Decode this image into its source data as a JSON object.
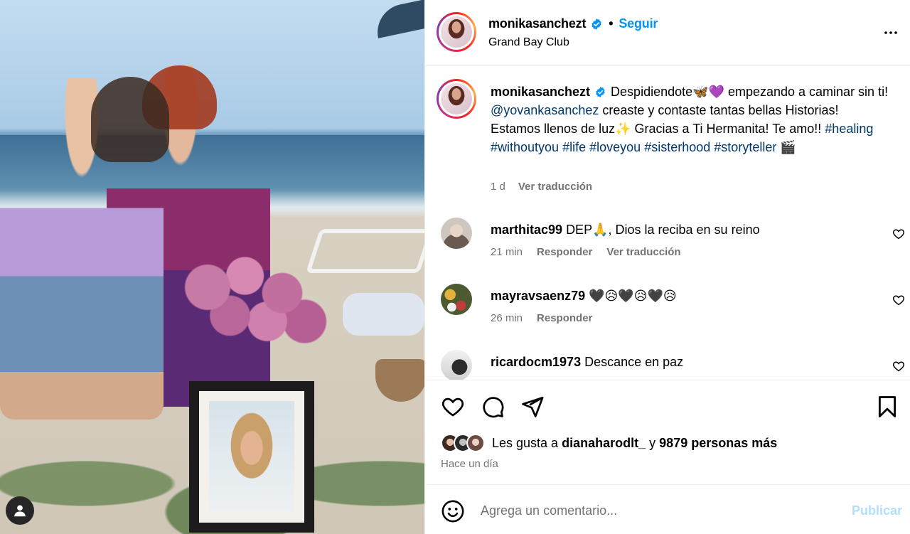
{
  "post": {
    "username": "monikasanchezt",
    "follow_label": "Seguir",
    "dot": "•",
    "location": "Grand Bay Club"
  },
  "caption": {
    "username": "monikasanchezt",
    "text_1": "Despidiendote🦋💜 empezando a caminar sin ti!",
    "mention": "@yovankasanchez",
    "text_2": "creaste y contaste tantas bellas Historias! Estamos llenos de luz✨ Gracias a Ti Hermanita! Te amo!!",
    "hashtags": [
      "#healing",
      "#withoutyou",
      "#life",
      "#loveyou",
      "#sisterhood",
      "#storyteller"
    ],
    "tail_emoji": "🎬",
    "age": "1 d",
    "translate_label": "Ver traducción"
  },
  "comments": [
    {
      "username": "marthitac99",
      "text": "DEP🙏, Dios la reciba en su reino",
      "age": "21 min",
      "reply_label": "Responder",
      "translate_label": "Ver traducción"
    },
    {
      "username": "mayravsaenz79",
      "text": "🖤😥🖤😥🖤😥",
      "age": "26 min",
      "reply_label": "Responder"
    },
    {
      "username": "ricardocm1973",
      "text": "Descance en paz"
    }
  ],
  "likes": {
    "prefix": "Les gusta a",
    "user": "dianaharodlt_",
    "connector": "y",
    "others": "9879 personas más",
    "time_ago": "Hace un día"
  },
  "composer": {
    "placeholder": "Agrega un comentario...",
    "publish_label": "Publicar"
  },
  "icons": {
    "verified": "verified-badge-icon",
    "more": "more-options-icon",
    "like": "heart-icon",
    "comment": "comment-bubble-icon",
    "share": "paper-plane-icon",
    "save": "bookmark-icon",
    "emoji": "smiley-icon",
    "tagged_user": "person-icon"
  },
  "colors": {
    "accent": "#0095f6",
    "link": "#00376b",
    "muted": "#737373",
    "publish_disabled": "#b2dffc"
  }
}
